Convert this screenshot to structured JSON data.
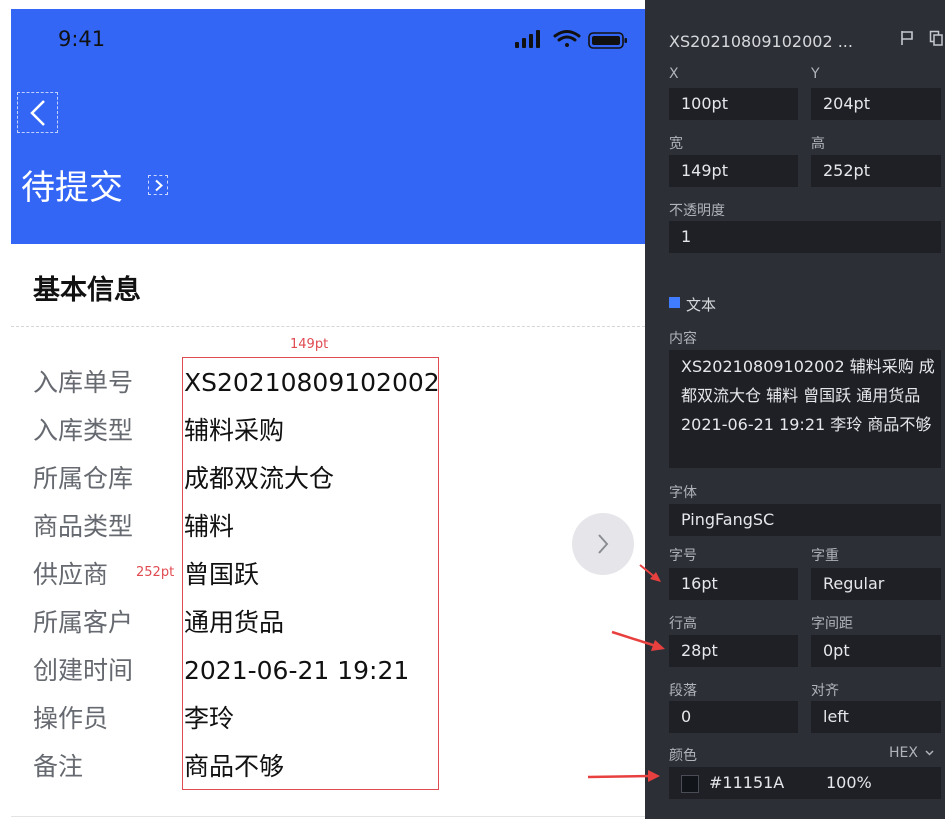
{
  "colors": {
    "header_bg": "#3366F5",
    "panel_bg": "#2C2F36",
    "field_bg": "#1E2026",
    "annotation_red": "#E04B52",
    "accent_blue": "#3F7CFF",
    "text_color": "#11151A"
  },
  "status_bar": {
    "time": "9:41",
    "icons": [
      "signal-icon",
      "wifi-icon",
      "battery-icon"
    ]
  },
  "header": {
    "back_icon": "chevron-left-icon",
    "title": "待提交",
    "title_arrow_icon": "chevron-right-icon"
  },
  "section": {
    "title": "基本信息"
  },
  "fields": [
    {
      "label": "入库单号",
      "value": "XS20210809102002"
    },
    {
      "label": "入库类型",
      "value": "辅料采购"
    },
    {
      "label": "所属仓库",
      "value": "成都双流大仓"
    },
    {
      "label": "商品类型",
      "value": "辅料"
    },
    {
      "label": "供应商",
      "value": "曾国跃"
    },
    {
      "label": "所属客户",
      "value": "通用货品"
    },
    {
      "label": "创建时间",
      "value": "2021-06-21 19:21"
    },
    {
      "label": "操作员",
      "value": "李玲"
    },
    {
      "label": "备注",
      "value": "商品不够"
    }
  ],
  "measure": {
    "width_label": "149pt",
    "height_label": "252pt"
  },
  "inspector": {
    "title": "XS20210809102002 ...",
    "x_label": "X",
    "x_value": "100pt",
    "y_label": "Y",
    "y_value": "204pt",
    "w_label": "宽",
    "w_value": "149pt",
    "h_label": "高",
    "h_value": "252pt",
    "opacity_label": "不透明度",
    "opacity_value": "1",
    "text_section": "文本",
    "content_label": "内容",
    "content_value": "XS20210809102002 辅料采购 成都双流大仓 辅料 曾国跃 通用货品 2021-06-21 19:21 李玲 商品不够",
    "font_label": "字体",
    "font_value": "PingFangSC",
    "size_label": "字号",
    "size_value": "16pt",
    "weight_label": "字重",
    "weight_value": "Regular",
    "line_height_label": "行高",
    "line_height_value": "28pt",
    "spacing_label": "字间距",
    "spacing_value": "0pt",
    "paragraph_label": "段落",
    "paragraph_value": "0",
    "align_label": "对齐",
    "align_value": "left",
    "color_label": "颜色",
    "color_format": "HEX",
    "color_hex": "#11151A",
    "color_opacity": "100%"
  }
}
